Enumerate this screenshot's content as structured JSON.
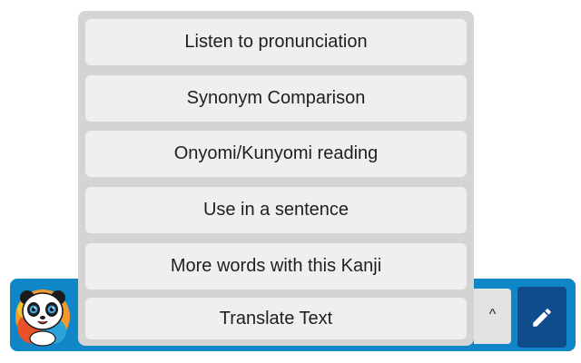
{
  "menu": {
    "items": [
      {
        "label": "Listen to pronunciation"
      },
      {
        "label": "Synonym Comparison"
      },
      {
        "label": "Onyomi/Kunyomi reading"
      },
      {
        "label": "Use in a sentence"
      },
      {
        "label": "More words with this Kanji"
      },
      {
        "label": "Translate Text"
      }
    ]
  },
  "toolbar": {
    "toggle_label": "^",
    "edit_icon": "pencil-icon",
    "avatar_icon": "panda-avatar"
  },
  "colors": {
    "toolbar_blue": "#0f86c6",
    "edit_button": "#0e4c8c",
    "menu_panel": "#d4d4d4",
    "menu_item": "#efefef"
  }
}
